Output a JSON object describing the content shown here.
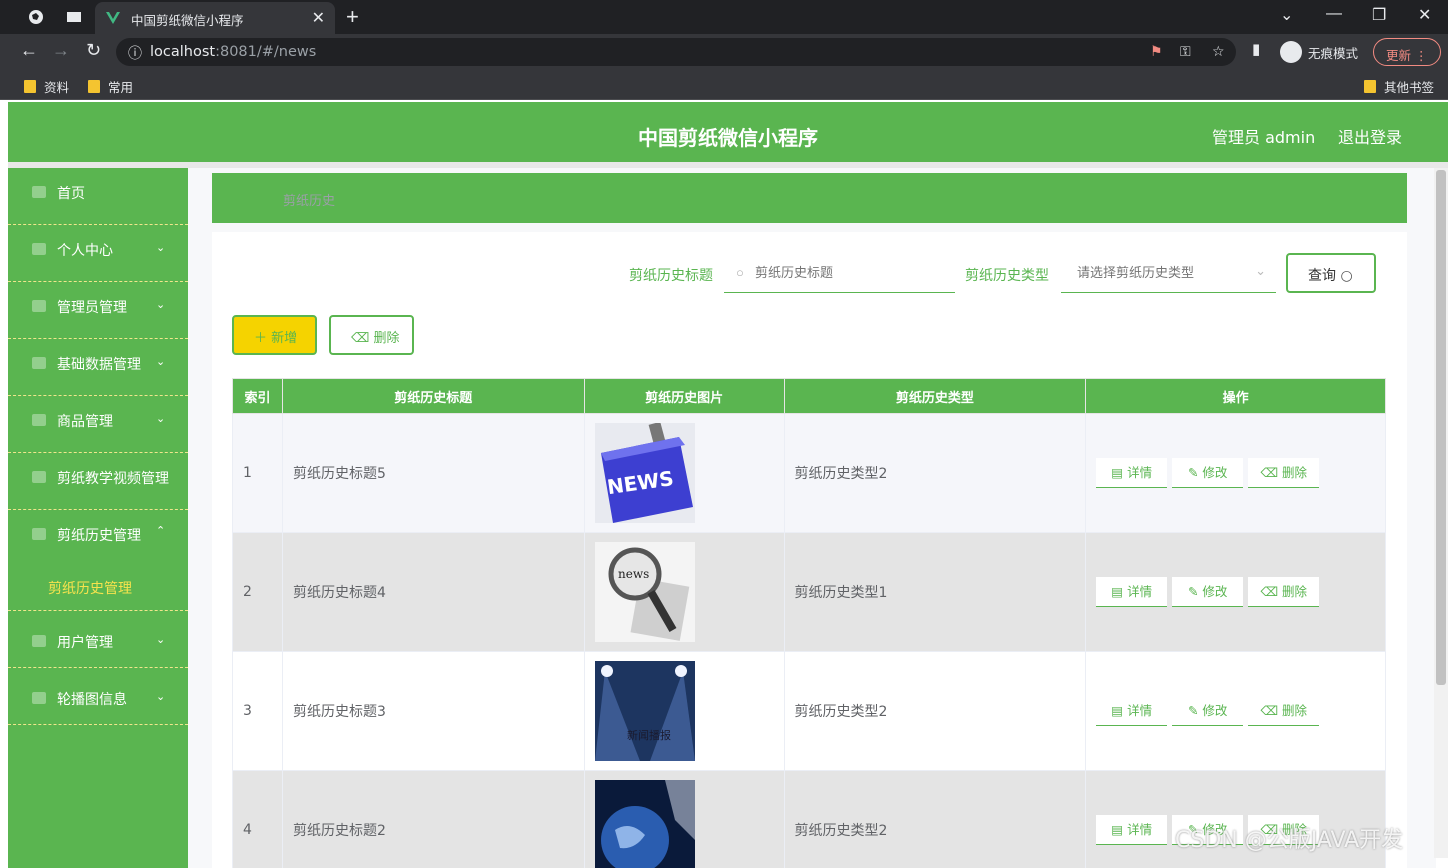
{
  "browser": {
    "tab_title": "中国剪纸微信小程序",
    "url_host": "localhost",
    "url_rest": ":8081/#/news",
    "incognito_label": "无痕模式",
    "update_label": "更新",
    "bookmarks": [
      "资料",
      "常用"
    ],
    "other_bookmarks": "其他书签"
  },
  "header": {
    "title": "中国剪纸微信小程序",
    "admin": "管理员 admin",
    "logout": "退出登录"
  },
  "sidebar": {
    "items": [
      {
        "label": "首页"
      },
      {
        "label": "个人中心"
      },
      {
        "label": "管理员管理"
      },
      {
        "label": "基础数据管理"
      },
      {
        "label": "商品管理"
      },
      {
        "label": "剪纸教学视频管理"
      },
      {
        "label": "剪纸历史管理"
      },
      {
        "label": "剪纸历史管理"
      },
      {
        "label": "用户管理"
      },
      {
        "label": "轮播图信息"
      }
    ]
  },
  "breadcrumb": "剪纸历史",
  "search": {
    "title_label": "剪纸历史标题",
    "title_placeholder": "剪纸历史标题",
    "type_label": "剪纸历史类型",
    "type_placeholder": "请选择剪纸历史类型",
    "query_label": "查询"
  },
  "actions": {
    "add_label": "新增",
    "delete_label": "删除"
  },
  "table": {
    "headers": [
      "索引",
      "剪纸历史标题",
      "剪纸历史图片",
      "剪纸历史类型",
      "操作"
    ],
    "rows": [
      {
        "index": "1",
        "title": "剪纸历史标题5",
        "type": "剪纸历史类型2",
        "image": "news-key"
      },
      {
        "index": "2",
        "title": "剪纸历史标题4",
        "type": "剪纸历史类型1",
        "image": "news-magnifier"
      },
      {
        "index": "3",
        "title": "剪纸历史标题3",
        "type": "剪纸历史类型2",
        "image": "news-stage"
      },
      {
        "index": "4",
        "title": "剪纸历史标题2",
        "type": "剪纸历史类型2",
        "image": "news-globe"
      }
    ],
    "row_actions": [
      "详情",
      "修改",
      "删除"
    ]
  },
  "images": {
    "news_key_text": "NEWS",
    "news_magnifier_text": "news",
    "news_stage_text": "新闻播报"
  },
  "watermark": "CSDN @公版JAVA开发",
  "colors": {
    "brand_green": "#5ab550",
    "accent_yellow": "#f5d300",
    "submenu_active": "#f7e34d"
  }
}
